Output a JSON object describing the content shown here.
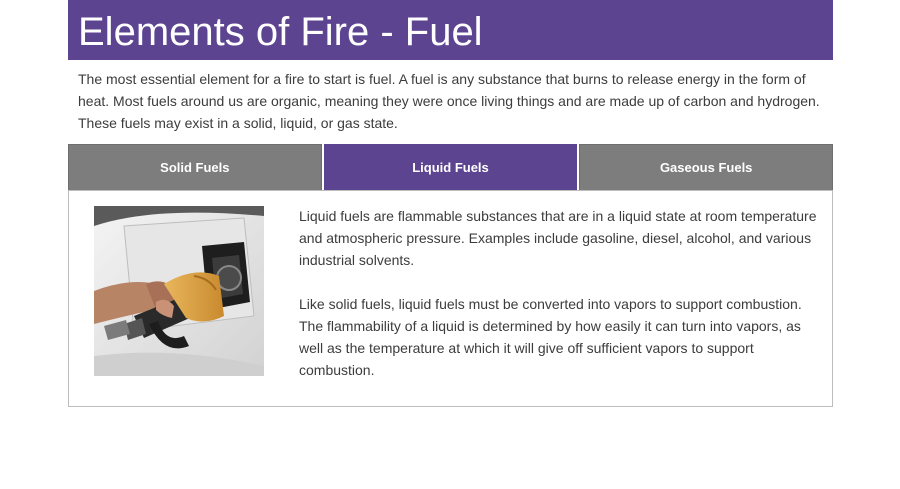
{
  "header": {
    "title": "Elements of Fire - Fuel"
  },
  "intro": {
    "text": "The most essential element for a fire to start is fuel. A fuel is any substance that burns to release energy in the form of heat. Most fuels around us are organic, meaning they were once living things and are made up of carbon and hydrogen. These fuels may exist in a solid, liquid, or gas state."
  },
  "tabs": [
    {
      "label": "Solid Fuels",
      "active": false
    },
    {
      "label": "Liquid Fuels",
      "active": true
    },
    {
      "label": "Gaseous Fuels",
      "active": false
    }
  ],
  "panel": {
    "image_icon": "fuel-nozzle-photo",
    "paragraphs": [
      "Liquid fuels are flammable substances that are in a liquid state at room temperature and atmospheric pressure. Examples include gasoline, diesel, alcohol, and various industrial solvents.",
      "Like solid fuels, liquid fuels must be converted into vapors to support combustion. The flammability of a liquid is determined by how easily it can turn into vapors, as well as the temperature at which it will give off sufficient vapors to support combustion."
    ]
  },
  "colors": {
    "accent": "#5c4491",
    "tab_inactive": "#7d7d7d",
    "text": "#3c3c3c"
  }
}
